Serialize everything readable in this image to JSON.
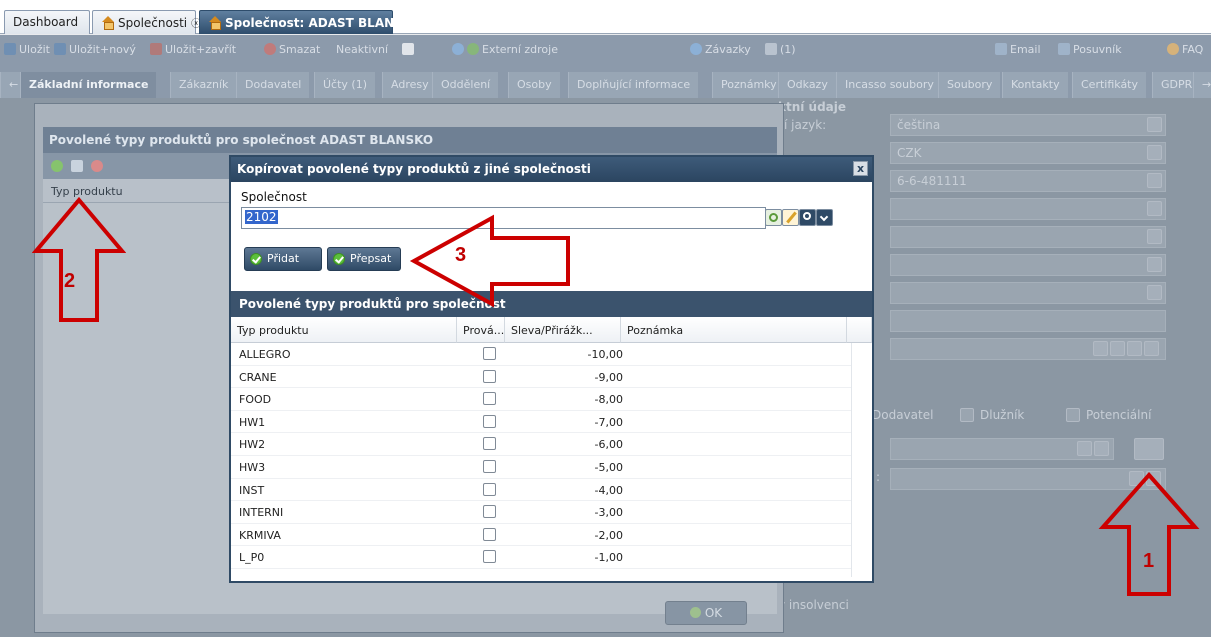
{
  "tabs": [
    {
      "label": "Dashboard",
      "active": false,
      "closable": false
    },
    {
      "label": "Společnosti",
      "active": false,
      "closable": true,
      "icon": "home-icon"
    },
    {
      "label": "Společnost: ADAST BLANSKO",
      "active": true,
      "closable": true,
      "icon": "home-icon"
    }
  ],
  "toolbar": {
    "items": [
      "Uložit",
      "Uložit+nový",
      "Uložit+zavřít",
      "Smazat",
      "Neaktivní",
      "Externí zdroje",
      "Závazky",
      "(1)",
      "Email",
      "Posuvník",
      "FAQ"
    ]
  },
  "subtabs": [
    "Základní informace",
    "Zákazník",
    "Dodavatel",
    "Účty (1)",
    "Adresy",
    "Oddělení",
    "Osoby",
    "Doplňující informace",
    "Poznámky",
    "Odkazy",
    "Incasso soubory",
    "Soubory",
    "Kontakty",
    "Certifikáty",
    "GDPR"
  ],
  "background_form": {
    "section_title": "ktní údaje",
    "language_label": "í jazyk:",
    "language_value": "čeština",
    "currency_value": "CZK",
    "account_value": "6-6-481111",
    "chk_supplier": "Dodavatel",
    "chk_debtor": "Dlužník",
    "chk_potential": "Potenciální",
    "insolvency_label": "v insolvenci",
    "colon": ":"
  },
  "dialog1": {
    "title": "Povolené typy produktů pro společnost ADAST BLANSKO",
    "column_header": "Typ produktu",
    "ok_label": "OK"
  },
  "dialog2": {
    "title": "Kopírovat povolené typy produktů z jiné společnosti",
    "close_label": "x",
    "company_label": "Společnost",
    "company_value": "2102",
    "btn_add": "Přidat",
    "btn_overwrite": "Přepsat",
    "grid_title": "Povolené typy produktů pro společnost",
    "columns": [
      "Typ produktu",
      "Prová...",
      "Sleva/Přirážk...",
      "Poznámka"
    ],
    "rows": [
      {
        "type": "ALLEGRO",
        "checked": false,
        "discount": "-10,00",
        "note": ""
      },
      {
        "type": "CRANE",
        "checked": false,
        "discount": "-9,00",
        "note": ""
      },
      {
        "type": "FOOD",
        "checked": false,
        "discount": "-8,00",
        "note": ""
      },
      {
        "type": "HW1",
        "checked": false,
        "discount": "-7,00",
        "note": ""
      },
      {
        "type": "HW2",
        "checked": false,
        "discount": "-6,00",
        "note": ""
      },
      {
        "type": "HW3",
        "checked": false,
        "discount": "-5,00",
        "note": ""
      },
      {
        "type": "INST",
        "checked": false,
        "discount": "-4,00",
        "note": ""
      },
      {
        "type": "INTERNI",
        "checked": false,
        "discount": "-3,00",
        "note": ""
      },
      {
        "type": "KRMIVA",
        "checked": false,
        "discount": "-2,00",
        "note": ""
      },
      {
        "type": "L_P0",
        "checked": false,
        "discount": "-1,00",
        "note": ""
      }
    ]
  },
  "annotations": [
    "1",
    "2",
    "3"
  ],
  "colors": {
    "annotation": "#cc0000",
    "dialog_header": "#2b4560",
    "accent_green": "#5bbf3a"
  }
}
